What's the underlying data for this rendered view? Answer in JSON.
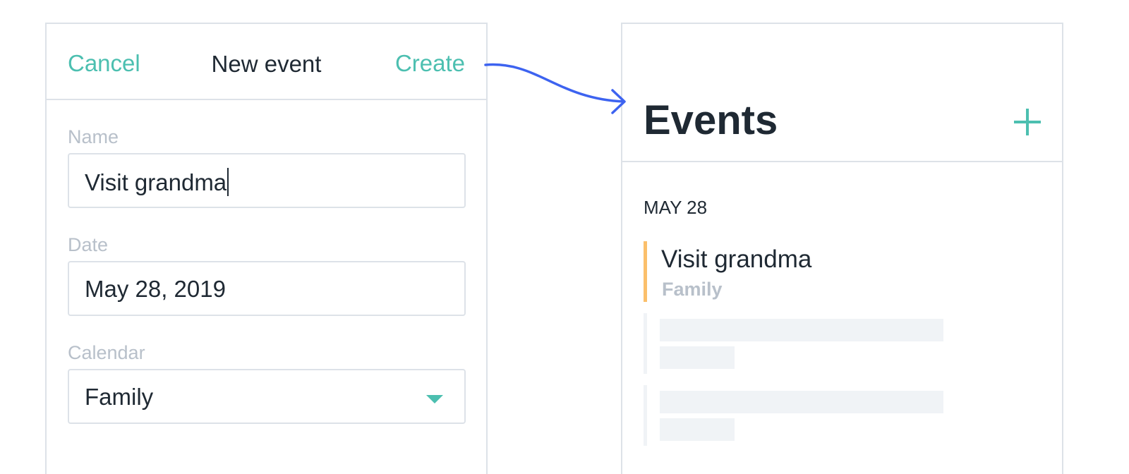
{
  "new_event_form": {
    "cancel_label": "Cancel",
    "title": "New event",
    "create_label": "Create",
    "fields": {
      "name": {
        "label": "Name",
        "value": "Visit grandma"
      },
      "date": {
        "label": "Date",
        "value": "May 28, 2019"
      },
      "calendar": {
        "label": "Calendar",
        "value": "Family"
      }
    }
  },
  "events_screen": {
    "title": "Events",
    "add_icon": "plus-icon",
    "date_heading": "MAY 28",
    "events": [
      {
        "name": "Visit grandma",
        "calendar": "Family",
        "color": "#fbbf6b"
      }
    ],
    "placeholder_rows": 2
  },
  "colors": {
    "accent": "#4cbfb0",
    "arrow": "#3d63f0",
    "border": "#dde2e8",
    "text": "#1f2933",
    "muted": "#b8c0ca",
    "placeholder": "#f0f3f6"
  }
}
